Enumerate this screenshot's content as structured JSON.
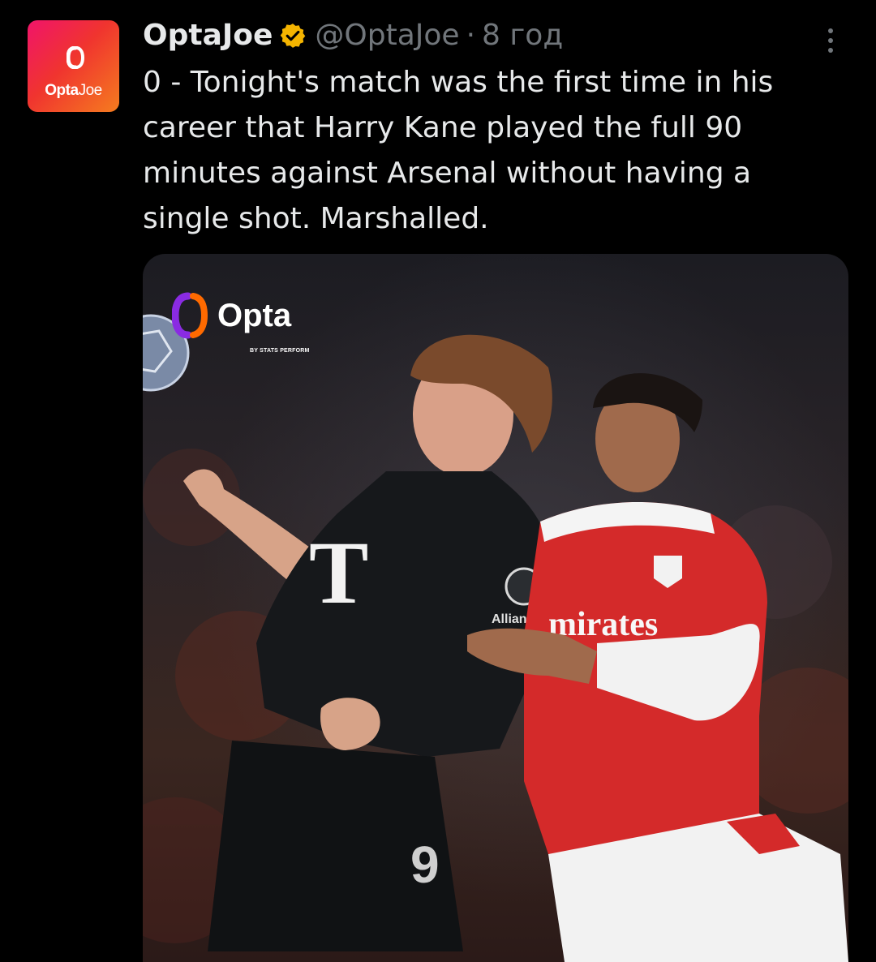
{
  "account": {
    "display_name": "OptaJoe",
    "handle": "@OptaJoe",
    "separator": "·",
    "time_ago": "8 год",
    "avatar_brand_bold": "Opta",
    "avatar_brand_light": "Joe"
  },
  "tweet": {
    "text": "0 - Tonight's match was the first time in his career that Harry Kane played the full 90 minutes against Arsenal without having a single shot. Marshalled."
  },
  "media": {
    "watermark_word": "Opta",
    "watermark_sub": "BY STATS PERFORM",
    "kit_text_sponsor": "mirates",
    "kit_text_sub": "Allianz"
  },
  "colors": {
    "background": "#000000",
    "text": "#e7e9ea",
    "muted": "#71767b",
    "verified": "#f4b400",
    "avatar_gradient_start": "#f0146a",
    "avatar_gradient_end": "#f57c1f"
  },
  "icons": {
    "verified": "verified-badge-icon",
    "more": "more-options-icon",
    "opta": "opta-logo-icon"
  }
}
